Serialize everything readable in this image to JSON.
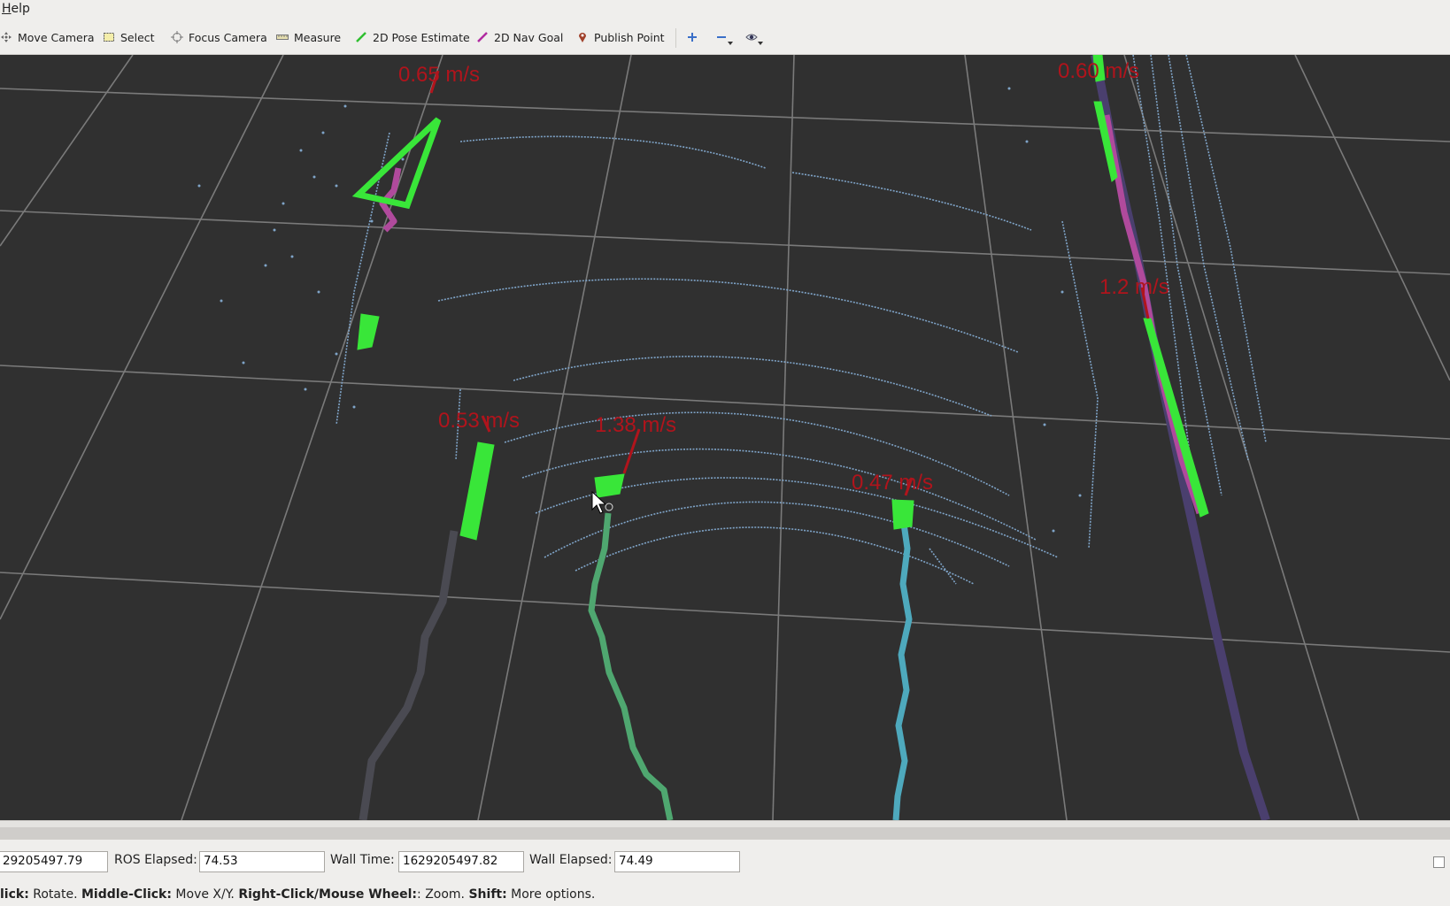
{
  "menubar": {
    "help_first": "H",
    "help_rest": "elp"
  },
  "toolbar": {
    "move_camera": "Move Camera",
    "select": "Select",
    "focus_camera": "Focus Camera",
    "measure": "Measure",
    "pose_estimate": "2D Pose Estimate",
    "nav_goal": "2D Nav Goal",
    "publish_point": "Publish Point"
  },
  "viewport": {
    "velocity_labels": [
      "0.65 m/s",
      "0.60 m/s",
      "1.2 m/s",
      "0.53 m/s",
      "1.38 m/s",
      "0.47 m/s"
    ]
  },
  "timepanel": {
    "ros_time_value": "29205497.79",
    "ros_elapsed_label": "ROS Elapsed:",
    "ros_elapsed_value": "74.53",
    "wall_time_label": "Wall Time:",
    "wall_time_value": "1629205497.82",
    "wall_elapsed_label": "Wall Elapsed:",
    "wall_elapsed_value": "74.49"
  },
  "statusbar": {
    "left_click": "lick:",
    "left_click_desc": " Rotate. ",
    "middle_click": "Middle-Click:",
    "middle_click_desc": " Move X/Y. ",
    "right_click": "Right-Click/Mouse Wheel:",
    "right_click_desc": ": Zoom. ",
    "shift": "Shift:",
    "shift_desc": " More options."
  },
  "colors": {
    "background": "#303030",
    "grid": "#8a8a8a",
    "laser": "#7fa4c8",
    "box": "#39e639",
    "velocity": "#b0141c",
    "track_green": "#4fa770",
    "track_cyan": "#4ea9bd",
    "track_purple": "#4a3f6e",
    "track_gray": "#4a4a52",
    "track_magenta": "#b04a9c"
  }
}
